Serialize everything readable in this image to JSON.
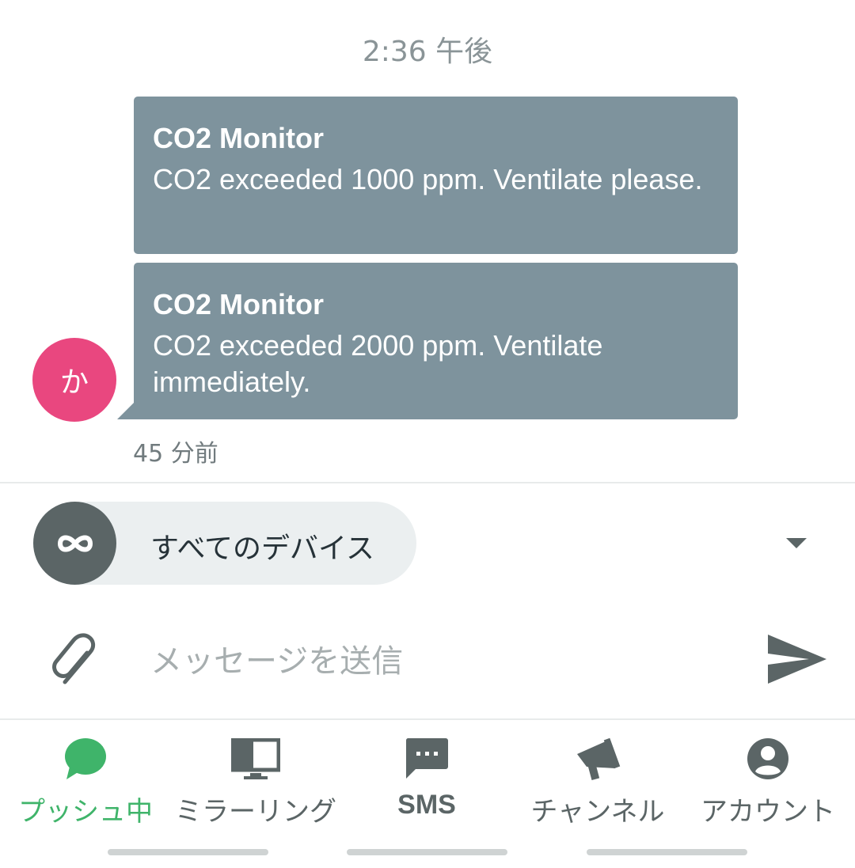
{
  "chat": {
    "time_header": "2:36 午後",
    "messages": [
      {
        "title": "CO2 Monitor",
        "body": "CO2 exceeded 1000 ppm. Ventilate please."
      },
      {
        "title": "CO2 Monitor",
        "body": "CO2 exceeded 2000 ppm. Ventilate immediately."
      }
    ],
    "sender_avatar_initial": "か",
    "relative_time": "45 分前"
  },
  "device_selector": {
    "label": "すべてのデバイス",
    "icon": "infinity-icon"
  },
  "composer": {
    "placeholder": "メッセージを送信",
    "value": "",
    "attach_icon": "paperclip-icon",
    "send_icon": "send-icon"
  },
  "bottom_nav": {
    "items": [
      {
        "label": "プッシュ中",
        "icon": "chat-bubble-icon",
        "active": true
      },
      {
        "label": "ミラーリング",
        "icon": "monitor-icon",
        "active": false
      },
      {
        "label": "SMS",
        "icon": "sms-icon",
        "active": false
      },
      {
        "label": "チャンネル",
        "icon": "megaphone-icon",
        "active": false
      },
      {
        "label": "アカウント",
        "icon": "account-circle-icon",
        "active": false
      }
    ]
  },
  "colors": {
    "bubble": "#7e939d",
    "avatar": "#e9477f",
    "active": "#3fb46a",
    "icon": "#5b6566"
  }
}
